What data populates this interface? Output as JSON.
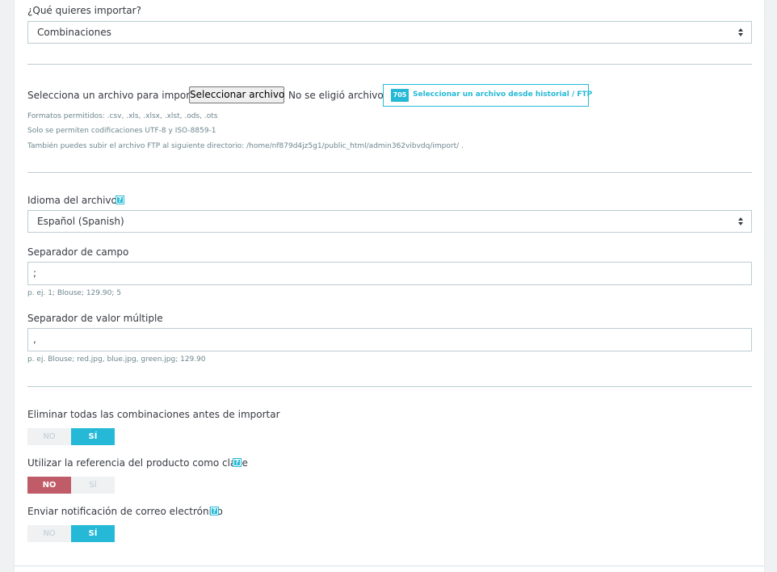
{
  "what_import": {
    "label": "¿Qué quieres importar?",
    "selected": "Combinaciones"
  },
  "file": {
    "prefix": "Selecciona un archivo para importar",
    "button": "Seleccionar archivo",
    "no_file": "No se eligió archivo o",
    "ftp_badge": "705",
    "ftp_button": "Seleccionar un archivo desde historial / FTP",
    "hint_formats": "Formatos permitidos: .csv, .xls, .xlsx, .xlst, .ods, .ots",
    "hint_encoding": "Solo se permiten codificaciones UTF-8 y ISO-8859-1",
    "hint_ftp": "También puedes subir el archivo FTP al siguiente directorio: /home/nf879d4jz5g1/public_html/admin362vibvdq/import/ ."
  },
  "language": {
    "label": "Idioma del archivo",
    "help": "?",
    "selected": "Español (Spanish)"
  },
  "field_sep": {
    "label": "Separador de campo",
    "value": ";",
    "hint": "p. ej. 1; Blouse; 129.90; 5"
  },
  "multi_sep": {
    "label": "Separador de valor múltiple",
    "value": ",",
    "hint": "p. ej. Blouse; red.jpg, blue.jpg, green.jpg; 129.90"
  },
  "delete_combos": {
    "label": "Eliminar todas las combinaciones antes de importar",
    "no": "NO",
    "yes": "SÍ",
    "selected": "yes"
  },
  "use_reference": {
    "label": "Utilizar la referencia del producto como clave",
    "help": "?",
    "no": "NO",
    "yes": "SÍ",
    "selected": "no"
  },
  "email_notify": {
    "label": "Enviar notificación de correo electrónico",
    "help": "?",
    "no": "NO",
    "yes": "SÍ",
    "selected": "yes"
  },
  "colors": {
    "accent": "#25b9d7",
    "danger": "#c05c67",
    "border": "#bbcdd2"
  }
}
